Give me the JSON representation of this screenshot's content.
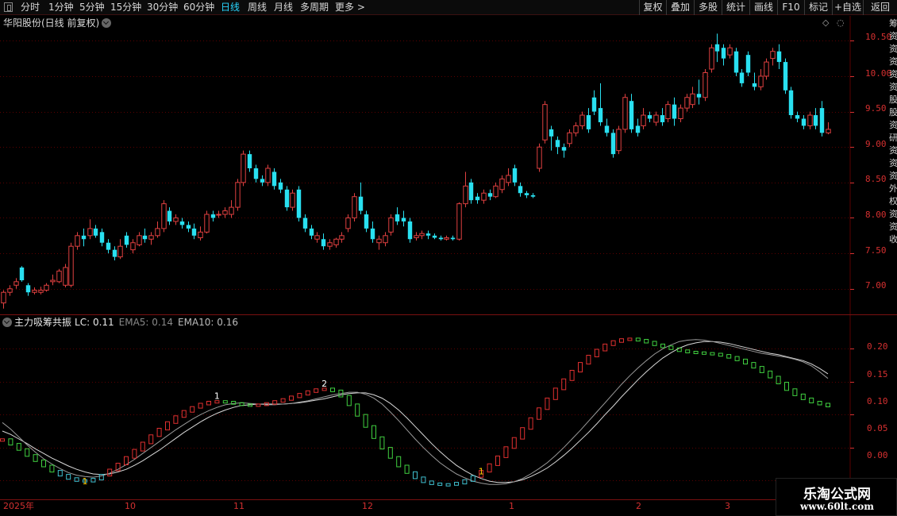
{
  "toolbar": {
    "periods": [
      "分时",
      "1分钟",
      "5分钟",
      "15分钟",
      "30分钟",
      "60分钟",
      "日线",
      "周线",
      "月线",
      "多周期",
      "更多 >"
    ],
    "active_period": "日线",
    "actions": [
      "复权",
      "叠加",
      "多股",
      "统计",
      "画线",
      "F10",
      "标记",
      "+自选",
      "返回"
    ]
  },
  "main_panel": {
    "title": "华阳股份(日线 前复权)",
    "y_ticks": [
      "10.50",
      "10.00",
      "9.50",
      "9.00",
      "8.50",
      "8.00",
      "7.50",
      "7.00"
    ]
  },
  "indicator_panel": {
    "name": "主力吸筹共振",
    "lc": "LC: 0.11",
    "ema5": "EMA5: 0.14",
    "ema10": "EMA10: 0.16",
    "y_ticks": [
      "0.20",
      "0.15",
      "0.10",
      "0.05",
      "0.00"
    ],
    "markers": [
      "1",
      "1",
      "2",
      "1"
    ]
  },
  "x_axis": {
    "labels": [
      "2025年",
      "10",
      "11",
      "12",
      "1",
      "2",
      "3"
    ]
  },
  "right_column": {
    "text": "筹资资资资资股股资研资资资外权资资收"
  },
  "watermark": {
    "line1": "乐淘公式网",
    "line2": "www.60lt.com"
  },
  "colors": {
    "up": "#e04040",
    "down": "#29e0f0",
    "grid": "#5a0000",
    "axis": "#d53030",
    "indicator_up": "#e03030",
    "indicator_down": "#40d040",
    "indicator_low": "#40c0d0",
    "active": "#29d6ff"
  },
  "chart_data": [
    {
      "type": "candlestick",
      "title": "华阳股份(日线 前复权)",
      "ylim": [
        6.65,
        10.75
      ],
      "x_labels": [
        "2025年",
        "10",
        "11",
        "12",
        "1",
        "2",
        "3"
      ],
      "candles": [
        [
          6.8,
          6.95,
          6.72,
          6.98
        ],
        [
          6.95,
          7.0,
          6.9,
          7.05
        ],
        [
          7.05,
          7.1,
          7.0,
          7.15
        ],
        [
          7.3,
          7.12,
          7.1,
          7.32
        ],
        [
          7.05,
          6.95,
          6.9,
          7.08
        ],
        [
          6.95,
          6.98,
          6.92,
          7.02
        ],
        [
          6.95,
          6.98,
          6.92,
          7.03
        ],
        [
          6.98,
          7.05,
          6.96,
          7.08
        ],
        [
          7.1,
          7.12,
          7.05,
          7.2
        ],
        [
          7.1,
          7.25,
          7.08,
          7.28
        ],
        [
          7.05,
          7.3,
          7.02,
          7.35
        ],
        [
          7.05,
          7.6,
          7.02,
          7.65
        ],
        [
          7.6,
          7.75,
          7.55,
          7.8
        ],
        [
          7.75,
          7.7,
          7.6,
          7.85
        ],
        [
          7.75,
          7.85,
          7.7,
          7.98
        ],
        [
          7.85,
          7.75,
          7.72,
          7.9
        ],
        [
          7.8,
          7.65,
          7.6,
          7.85
        ],
        [
          7.65,
          7.55,
          7.5,
          7.7
        ],
        [
          7.55,
          7.45,
          7.4,
          7.6
        ],
        [
          7.45,
          7.6,
          7.42,
          7.7
        ],
        [
          7.75,
          7.62,
          7.58,
          7.8
        ],
        [
          7.55,
          7.65,
          7.5,
          7.7
        ],
        [
          7.62,
          7.75,
          7.6,
          7.8
        ],
        [
          7.75,
          7.7,
          7.65,
          7.85
        ],
        [
          7.7,
          7.75,
          7.62,
          7.8
        ],
        [
          7.75,
          7.85,
          7.72,
          7.95
        ],
        [
          7.85,
          8.2,
          7.8,
          8.25
        ],
        [
          8.1,
          7.95,
          7.9,
          8.15
        ],
        [
          7.95,
          8.0,
          7.9,
          8.05
        ],
        [
          7.95,
          7.9,
          7.85,
          8.0
        ],
        [
          7.9,
          7.85,
          7.8,
          7.95
        ],
        [
          7.85,
          7.75,
          7.7,
          7.92
        ],
        [
          7.72,
          7.8,
          7.68,
          7.88
        ],
        [
          7.8,
          8.05,
          7.78,
          8.1
        ],
        [
          8.05,
          8.0,
          7.95,
          8.1
        ],
        [
          8.05,
          8.05,
          8.0,
          8.1
        ],
        [
          8.05,
          8.1,
          8.0,
          8.15
        ],
        [
          8.05,
          8.15,
          8.0,
          8.25
        ],
        [
          8.15,
          8.5,
          8.1,
          8.55
        ],
        [
          8.5,
          8.9,
          8.45,
          8.95
        ],
        [
          8.9,
          8.7,
          8.65,
          8.95
        ],
        [
          8.7,
          8.55,
          8.5,
          8.75
        ],
        [
          8.55,
          8.5,
          8.45,
          8.6
        ],
        [
          8.5,
          8.7,
          8.45,
          8.75
        ],
        [
          8.65,
          8.45,
          8.4,
          8.7
        ],
        [
          8.5,
          8.4,
          8.35,
          8.55
        ],
        [
          8.4,
          8.15,
          8.1,
          8.45
        ],
        [
          8.15,
          8.35,
          8.1,
          8.4
        ],
        [
          8.4,
          8.0,
          7.95,
          8.45
        ],
        [
          8.0,
          7.85,
          7.8,
          8.05
        ],
        [
          7.85,
          7.75,
          7.7,
          7.9
        ],
        [
          7.7,
          7.75,
          7.65,
          7.8
        ],
        [
          7.7,
          7.6,
          7.55,
          7.78
        ],
        [
          7.6,
          7.65,
          7.55,
          7.7
        ],
        [
          7.62,
          7.7,
          7.58,
          7.72
        ],
        [
          7.7,
          7.75,
          7.65,
          7.8
        ],
        [
          7.85,
          8.0,
          7.8,
          8.05
        ],
        [
          8.0,
          8.3,
          7.95,
          8.35
        ],
        [
          8.3,
          8.1,
          8.05,
          8.5
        ],
        [
          8.05,
          7.85,
          7.8,
          8.1
        ],
        [
          7.85,
          7.7,
          7.65,
          7.95
        ],
        [
          7.65,
          7.7,
          7.55,
          7.75
        ],
        [
          7.65,
          7.75,
          7.6,
          7.8
        ],
        [
          7.8,
          8.0,
          7.75,
          8.05
        ],
        [
          8.05,
          7.95,
          7.9,
          8.15
        ],
        [
          8.0,
          7.95,
          7.88,
          8.1
        ],
        [
          7.95,
          7.7,
          7.65,
          8.0
        ],
        [
          7.72,
          7.75,
          7.68,
          7.8
        ],
        [
          7.75,
          7.78,
          7.7,
          7.82
        ],
        [
          7.78,
          7.75,
          7.7,
          7.82
        ],
        [
          7.75,
          7.72,
          7.7,
          7.78
        ],
        [
          7.72,
          7.7,
          7.68,
          7.75
        ],
        [
          7.7,
          7.72,
          7.68,
          7.75
        ],
        [
          7.72,
          7.7,
          7.68,
          7.75
        ],
        [
          7.7,
          8.2,
          7.68,
          8.22
        ],
        [
          8.2,
          8.45,
          8.15,
          8.65
        ],
        [
          8.5,
          8.25,
          8.2,
          8.55
        ],
        [
          8.3,
          8.25,
          8.2,
          8.35
        ],
        [
          8.25,
          8.35,
          8.2,
          8.4
        ],
        [
          8.35,
          8.3,
          8.25,
          8.4
        ],
        [
          8.3,
          8.45,
          8.28,
          8.5
        ],
        [
          8.4,
          8.55,
          8.35,
          8.6
        ],
        [
          8.5,
          8.6,
          8.45,
          8.7
        ],
        [
          8.7,
          8.5,
          8.45,
          8.75
        ],
        [
          8.45,
          8.35,
          8.3,
          8.5
        ],
        [
          8.35,
          8.32,
          8.28,
          8.38
        ],
        [
          8.32,
          8.3,
          8.28,
          8.35
        ],
        [
          8.7,
          9.0,
          8.65,
          9.05
        ],
        [
          9.1,
          9.6,
          9.05,
          9.65
        ],
        [
          9.25,
          9.15,
          8.95,
          9.3
        ],
        [
          9.1,
          9.0,
          8.9,
          9.15
        ],
        [
          9.0,
          8.95,
          8.85,
          9.05
        ],
        [
          9.05,
          9.2,
          9.0,
          9.25
        ],
        [
          9.2,
          9.3,
          9.15,
          9.35
        ],
        [
          9.3,
          9.45,
          9.25,
          9.5
        ],
        [
          9.45,
          9.25,
          9.2,
          9.55
        ],
        [
          9.7,
          9.5,
          9.45,
          9.8
        ],
        [
          9.55,
          9.35,
          9.3,
          9.9
        ],
        [
          9.3,
          9.2,
          9.15,
          9.4
        ],
        [
          9.2,
          8.9,
          8.85,
          9.25
        ],
        [
          8.95,
          9.25,
          8.9,
          9.3
        ],
        [
          9.25,
          9.7,
          9.2,
          9.75
        ],
        [
          9.65,
          9.25,
          9.2,
          9.75
        ],
        [
          9.3,
          9.2,
          9.15,
          9.4
        ],
        [
          9.3,
          9.45,
          9.25,
          9.55
        ],
        [
          9.45,
          9.4,
          9.35,
          9.5
        ],
        [
          9.35,
          9.45,
          9.3,
          9.5
        ],
        [
          9.45,
          9.35,
          9.3,
          9.55
        ],
        [
          9.4,
          9.6,
          9.35,
          9.65
        ],
        [
          9.6,
          9.4,
          9.3,
          9.7
        ],
        [
          9.4,
          9.55,
          9.35,
          9.6
        ],
        [
          9.55,
          9.7,
          9.5,
          9.75
        ],
        [
          9.6,
          9.75,
          9.55,
          9.85
        ],
        [
          9.75,
          9.7,
          9.6,
          9.95
        ],
        [
          9.7,
          10.05,
          9.65,
          10.1
        ],
        [
          10.1,
          10.4,
          10.05,
          10.45
        ],
        [
          10.45,
          10.35,
          10.2,
          10.6
        ],
        [
          10.4,
          10.25,
          10.15,
          10.45
        ],
        [
          10.3,
          10.4,
          10.25,
          10.45
        ],
        [
          10.35,
          10.05,
          10.0,
          10.4
        ],
        [
          10.05,
          9.9,
          9.85,
          10.1
        ],
        [
          10.3,
          10.05,
          10.0,
          10.35
        ],
        [
          9.9,
          9.85,
          9.8,
          10.05
        ],
        [
          9.85,
          10.0,
          9.8,
          10.1
        ],
        [
          10.0,
          10.2,
          9.95,
          10.25
        ],
        [
          10.25,
          10.35,
          10.15,
          10.4
        ],
        [
          10.35,
          10.2,
          10.1,
          10.45
        ],
        [
          10.2,
          9.8,
          9.75,
          10.25
        ],
        [
          9.8,
          9.45,
          9.4,
          9.85
        ],
        [
          9.45,
          9.4,
          9.35,
          9.5
        ],
        [
          9.4,
          9.3,
          9.25,
          9.45
        ],
        [
          9.3,
          9.45,
          9.25,
          9.5
        ],
        [
          9.45,
          9.3,
          9.25,
          9.55
        ],
        [
          9.55,
          9.2,
          9.15,
          9.65
        ],
        [
          9.2,
          9.25,
          9.18,
          9.35
        ]
      ]
    },
    {
      "type": "line",
      "title": "主力吸筹共振",
      "ylim": [
        -0.025,
        0.245
      ],
      "series": [
        {
          "name": "EMA5",
          "values": [
            0.088,
            0.078,
            0.066,
            0.054,
            0.043,
            0.033,
            0.025,
            0.018,
            0.012,
            0.008,
            0.006,
            0.005,
            0.007,
            0.011,
            0.017,
            0.024,
            0.032,
            0.041,
            0.05,
            0.059,
            0.068,
            0.077,
            0.085,
            0.093,
            0.1,
            0.106,
            0.111,
            0.115,
            0.117,
            0.118,
            0.117,
            0.116,
            0.115,
            0.115,
            0.116,
            0.117,
            0.119,
            0.121,
            0.124,
            0.127,
            0.13,
            0.132,
            0.134,
            0.134,
            0.131,
            0.125,
            0.116,
            0.104,
            0.091,
            0.077,
            0.063,
            0.05,
            0.038,
            0.027,
            0.018,
            0.01,
            0.004,
            -0.001,
            -0.004,
            -0.006,
            -0.006,
            -0.005,
            -0.002,
            0.003,
            0.01,
            0.018,
            0.027,
            0.038,
            0.05,
            0.063,
            0.076,
            0.09,
            0.104,
            0.118,
            0.132,
            0.146,
            0.159,
            0.171,
            0.182,
            0.192,
            0.2,
            0.206,
            0.211,
            0.213,
            0.214,
            0.213,
            0.211,
            0.208,
            0.205,
            0.202,
            0.199,
            0.196,
            0.193,
            0.191,
            0.189,
            0.187,
            0.184,
            0.18,
            0.174,
            0.165,
            0.155
          ]
        },
        {
          "name": "EMA10",
          "values": [
            0.075,
            0.07,
            0.063,
            0.056,
            0.048,
            0.041,
            0.034,
            0.028,
            0.022,
            0.017,
            0.013,
            0.01,
            0.009,
            0.01,
            0.013,
            0.017,
            0.023,
            0.03,
            0.038,
            0.046,
            0.055,
            0.064,
            0.073,
            0.081,
            0.089,
            0.096,
            0.102,
            0.107,
            0.111,
            0.114,
            0.115,
            0.116,
            0.116,
            0.116,
            0.116,
            0.117,
            0.118,
            0.12,
            0.122,
            0.124,
            0.127,
            0.13,
            0.132,
            0.133,
            0.133,
            0.13,
            0.125,
            0.117,
            0.107,
            0.095,
            0.082,
            0.069,
            0.056,
            0.044,
            0.033,
            0.023,
            0.015,
            0.008,
            0.003,
            -0.001,
            -0.003,
            -0.003,
            -0.002,
            0.001,
            0.006,
            0.012,
            0.019,
            0.028,
            0.038,
            0.049,
            0.061,
            0.073,
            0.086,
            0.1,
            0.113,
            0.127,
            0.14,
            0.153,
            0.165,
            0.176,
            0.186,
            0.194,
            0.201,
            0.206,
            0.209,
            0.211,
            0.211,
            0.21,
            0.208,
            0.205,
            0.202,
            0.199,
            0.196,
            0.193,
            0.191,
            0.188,
            0.185,
            0.182,
            0.177,
            0.17,
            0.162
          ]
        },
        {
          "name": "LC",
          "values": [
            0.062,
            0.055,
            0.047,
            0.038,
            0.03,
            0.022,
            0.014,
            0.008,
            0.003,
            0.0,
            -0.001,
            0.002,
            0.008,
            0.016,
            0.025,
            0.035,
            0.046,
            0.057,
            0.068,
            0.078,
            0.088,
            0.097,
            0.105,
            0.111,
            0.116,
            0.119,
            0.12,
            0.119,
            0.117,
            0.115,
            0.114,
            0.115,
            0.117,
            0.12,
            0.123,
            0.127,
            0.131,
            0.135,
            0.138,
            0.139,
            0.136,
            0.128,
            0.115,
            0.099,
            0.082,
            0.065,
            0.049,
            0.035,
            0.022,
            0.012,
            0.004,
            -0.002,
            -0.005,
            -0.006,
            -0.006,
            -0.004,
            0.0,
            0.006,
            0.014,
            0.024,
            0.036,
            0.05,
            0.064,
            0.079,
            0.094,
            0.109,
            0.124,
            0.139,
            0.153,
            0.166,
            0.178,
            0.189,
            0.198,
            0.206,
            0.211,
            0.214,
            0.215,
            0.213,
            0.21,
            0.206,
            0.203,
            0.2,
            0.197,
            0.195,
            0.194,
            0.193,
            0.192,
            0.19,
            0.187,
            0.183,
            0.178,
            0.172,
            0.165,
            0.157,
            0.148,
            0.138,
            0.13,
            0.124,
            0.119,
            0.116,
            0.113
          ]
        }
      ]
    }
  ]
}
